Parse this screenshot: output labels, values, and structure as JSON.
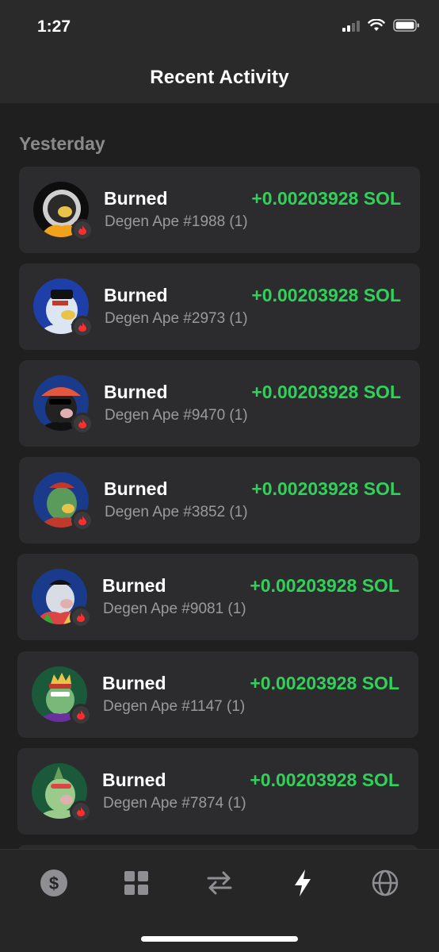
{
  "status_bar": {
    "time": "1:27"
  },
  "header": {
    "title": "Recent Activity"
  },
  "section": {
    "label": "Yesterday"
  },
  "activity": [
    {
      "action": "Burned",
      "amount": "+0.00203928 SOL",
      "item": "Degen Ape #1988 (1)"
    },
    {
      "action": "Burned",
      "amount": "+0.00203928 SOL",
      "item": "Degen Ape #2973 (1)"
    },
    {
      "action": "Burned",
      "amount": "+0.00203928 SOL",
      "item": "Degen Ape #9470 (1)"
    },
    {
      "action": "Burned",
      "amount": "+0.00203928 SOL",
      "item": "Degen Ape #3852 (1)"
    },
    {
      "action": "Burned",
      "amount": "+0.00203928 SOL",
      "item": "Degen Ape #9081 (1)"
    },
    {
      "action": "Burned",
      "amount": "+0.00203928 SOL",
      "item": "Degen Ape #1147 (1)"
    },
    {
      "action": "Burned",
      "amount": "+0.00203928 SOL",
      "item": "Degen Ape #7874 (1)"
    }
  ],
  "tabs": [
    {
      "icon": "dollar-icon",
      "active": false
    },
    {
      "icon": "grid-icon",
      "active": false
    },
    {
      "icon": "swap-icon",
      "active": false
    },
    {
      "icon": "lightning-icon",
      "active": true
    },
    {
      "icon": "globe-icon",
      "active": false
    }
  ],
  "colors": {
    "positive": "#30d158",
    "burn": "#ff2d2d",
    "card": "#2c2c2e",
    "background": "#1f1f1f"
  }
}
